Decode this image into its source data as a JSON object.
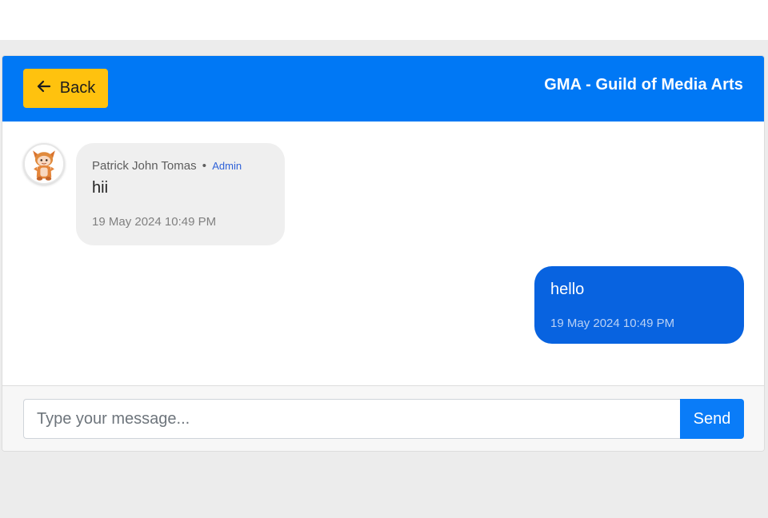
{
  "header": {
    "back_label": "Back",
    "title": "GMA - Guild of Media Arts"
  },
  "messages": [
    {
      "direction": "incoming",
      "sender": "Patrick John Tomas",
      "separator": "•",
      "role": "Admin",
      "text": "hii",
      "timestamp": "19 May 2024 10:49 PM"
    },
    {
      "direction": "outgoing",
      "text": "hello",
      "timestamp": "19 May 2024 10:49 PM"
    }
  ],
  "composer": {
    "placeholder": "Type your message...",
    "value": "",
    "send_label": "Send"
  },
  "icons": {
    "back": "arrow-left-icon",
    "avatar": "avatar-image"
  },
  "colors": {
    "header_bg": "#0078f5",
    "back_button_bg": "#ffc20e",
    "outgoing_bubble": "#0863e0",
    "incoming_bubble": "#efefef",
    "send_button_bg": "#0a7cf8",
    "role_text": "#2f62d8"
  }
}
